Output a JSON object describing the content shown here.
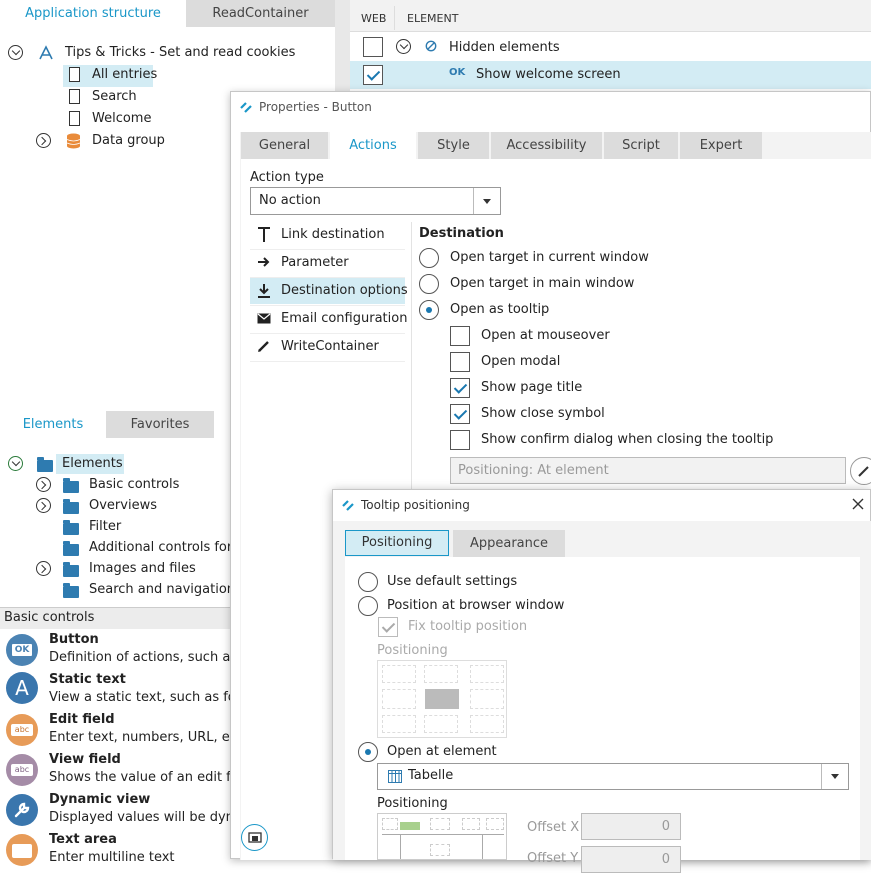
{
  "left_panel": {
    "tabs": [
      "Application structure",
      "ReadContainer"
    ],
    "tree": {
      "root": "Tips & Tricks - Set and read cookies",
      "children": [
        "All entries",
        "Search",
        "Welcome",
        "Data group"
      ]
    }
  },
  "web_table": {
    "headers": [
      "WEB",
      "ELEMENT"
    ],
    "rows": [
      {
        "label": "Hidden elements",
        "web_checked": false
      },
      {
        "label": "Show welcome screen",
        "badge": "OK",
        "web_checked": true
      }
    ]
  },
  "elements_panel": {
    "tabs": [
      "Elements",
      "Favorites"
    ],
    "root": "Elements",
    "items": [
      "Basic controls",
      "Overviews",
      "Filter",
      "Additional controls for c",
      "Images and files",
      "Search and navigation"
    ]
  },
  "basic_controls": {
    "header": "Basic controls",
    "items": [
      {
        "title": "Button",
        "desc": "Definition of actions, such as sa",
        "icon_text": "OK",
        "color": "#4b83b3"
      },
      {
        "title": "Static text",
        "desc": "View a static text, such as for d",
        "icon_text": "A",
        "color": "#3a76ad"
      },
      {
        "title": "Edit field",
        "desc": "Enter text, numbers, URL, ema",
        "icon_text": "abc",
        "color": "#e79b58"
      },
      {
        "title": "View field",
        "desc": "Shows the value of an edit field",
        "icon_text": "abc",
        "color": "#a58ca7"
      },
      {
        "title": "Dynamic view",
        "desc": "Displayed values will be dynam",
        "icon_text": "",
        "color": "#3a76ad"
      },
      {
        "title": "Text area",
        "desc": "Enter multiline text",
        "icon_text": "",
        "color": "#e79b58"
      }
    ]
  },
  "properties": {
    "title": "Properties - Button",
    "tabs": [
      "General",
      "Actions",
      "Style",
      "Accessibility",
      "Script",
      "Expert"
    ],
    "active_tab": "Actions",
    "action_type_label": "Action type",
    "action_type_value": "No action",
    "side_menu": [
      {
        "label": "Link destination",
        "icon": "pin-icon"
      },
      {
        "label": "Parameter",
        "icon": "arrow-right-icon"
      },
      {
        "label": "Destination options",
        "icon": "download-icon",
        "active": true
      },
      {
        "label": "Email configuration",
        "icon": "envelope-icon"
      },
      {
        "label": "WriteContainer",
        "icon": "pencil-icon"
      }
    ],
    "destination": {
      "title": "Destination",
      "radios": [
        {
          "label": "Open target in current window",
          "checked": false
        },
        {
          "label": "Open target in main window",
          "checked": false
        },
        {
          "label": "Open as tooltip",
          "checked": true
        }
      ],
      "checks": [
        {
          "label": "Open at mouseover",
          "checked": false
        },
        {
          "label": "Open modal",
          "checked": false
        },
        {
          "label": "Show page title",
          "checked": true
        },
        {
          "label": "Show close symbol",
          "checked": true
        },
        {
          "label": "Show confirm dialog when closing the tooltip",
          "checked": false
        }
      ],
      "positioning_field": "Positioning: At element"
    }
  },
  "tooltip_dialog": {
    "title": "Tooltip positioning",
    "tabs": [
      "Positioning",
      "Appearance"
    ],
    "active_tab": "Positioning",
    "options": {
      "use_default": "Use default settings",
      "browser_window": "Position at browser window",
      "fix_position": "Fix tooltip position",
      "positioning_label": "Positioning",
      "open_at_element": "Open at element",
      "element_value": "Tabelle",
      "positioning_label2": "Positioning",
      "offset_x_label": "Offset X",
      "offset_x_value": "0",
      "offset_y_label": "Offset Y",
      "offset_y_value": "0"
    },
    "selected": "Open at element"
  },
  "colors": {
    "accent": "#1a97c8",
    "highlight": "#d3ecf4",
    "tab_bg": "#dcdcdc"
  }
}
